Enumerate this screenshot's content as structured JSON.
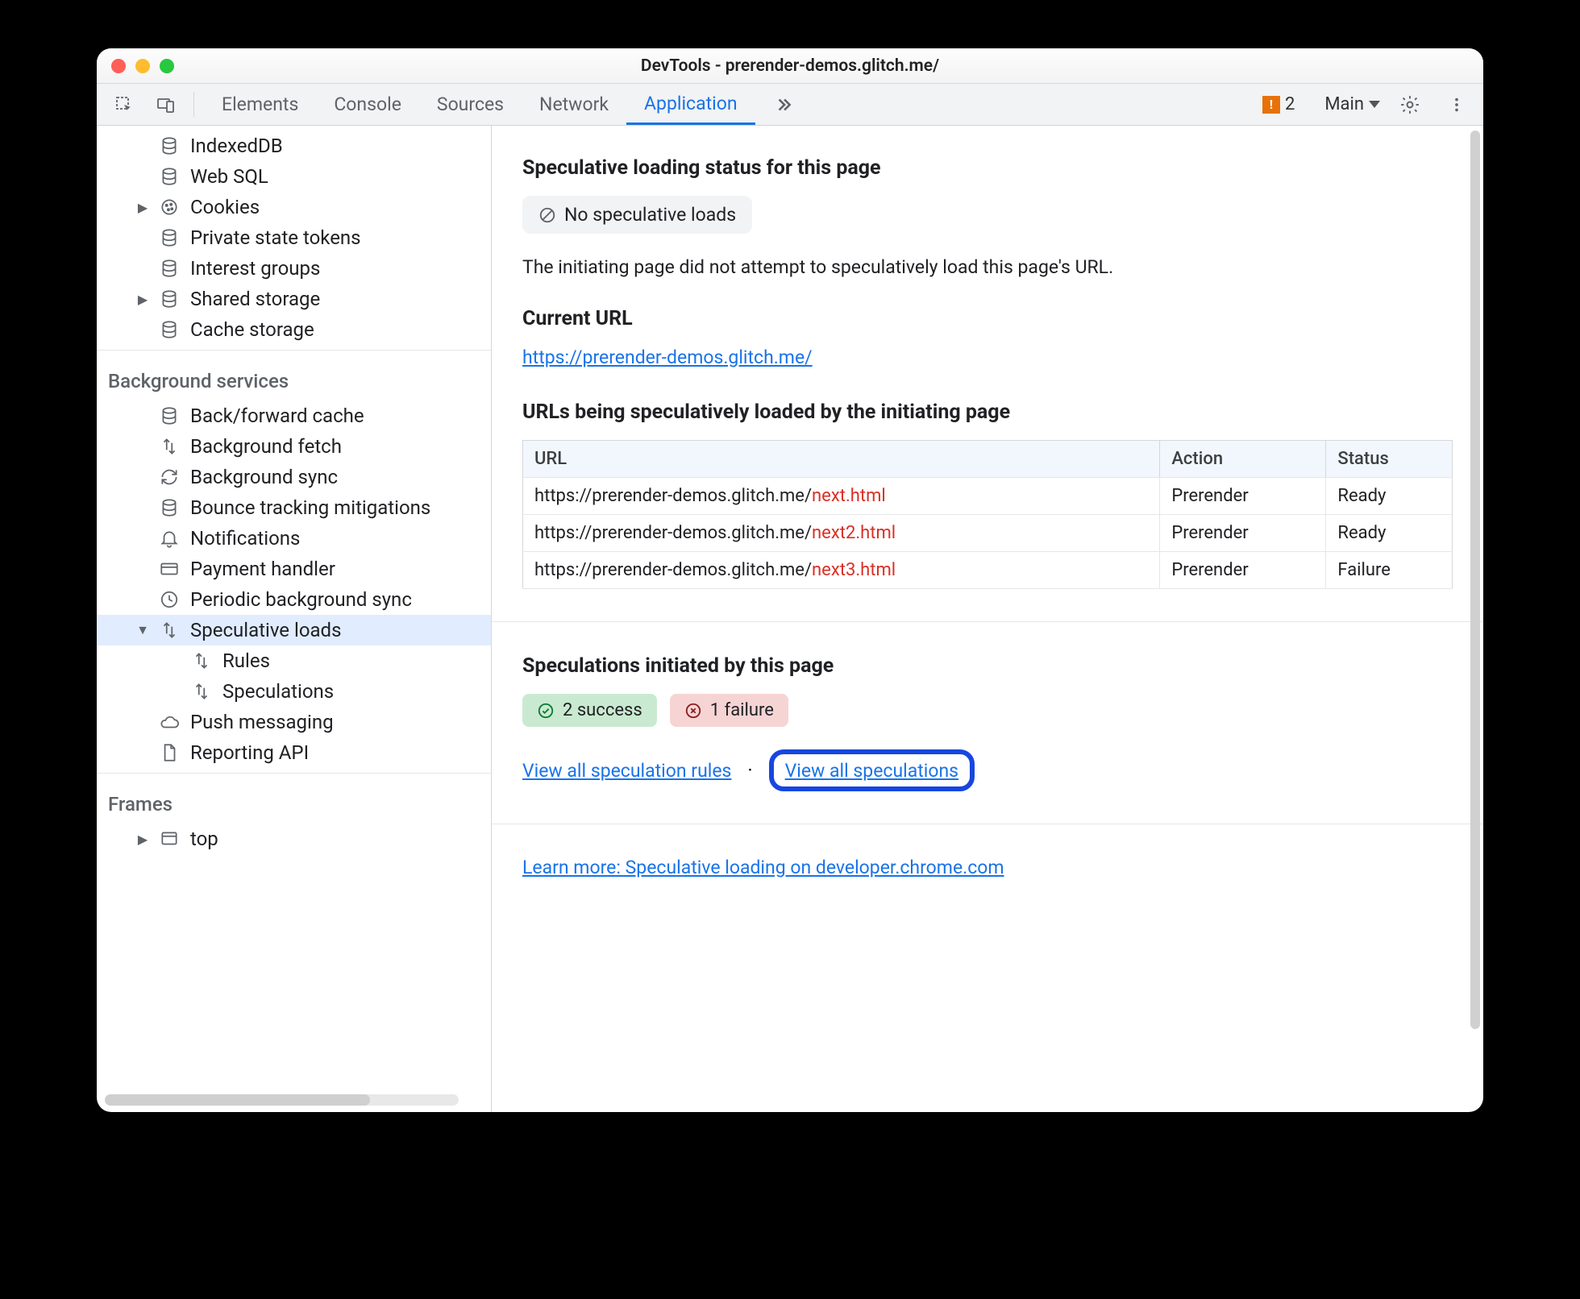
{
  "window": {
    "title": "DevTools - prerender-demos.glitch.me/"
  },
  "toolbar": {
    "tabs": [
      "Elements",
      "Console",
      "Sources",
      "Network",
      "Application"
    ],
    "active_tab": "Application",
    "issues_count": "2",
    "target_label": "Main"
  },
  "sidebar": {
    "storage_items": [
      {
        "label": "IndexedDB",
        "icon": "db"
      },
      {
        "label": "Web SQL",
        "icon": "db"
      },
      {
        "label": "Cookies",
        "icon": "cookie",
        "expandable": true
      },
      {
        "label": "Private state tokens",
        "icon": "db"
      },
      {
        "label": "Interest groups",
        "icon": "db"
      },
      {
        "label": "Shared storage",
        "icon": "db",
        "expandable": true
      },
      {
        "label": "Cache storage",
        "icon": "db"
      }
    ],
    "bg_label": "Background services",
    "bg_items": [
      {
        "label": "Back/forward cache",
        "icon": "db"
      },
      {
        "label": "Background fetch",
        "icon": "updown"
      },
      {
        "label": "Background sync",
        "icon": "sync"
      },
      {
        "label": "Bounce tracking mitigations",
        "icon": "db"
      },
      {
        "label": "Notifications",
        "icon": "bell"
      },
      {
        "label": "Payment handler",
        "icon": "card"
      },
      {
        "label": "Periodic background sync",
        "icon": "clock"
      },
      {
        "label": "Speculative loads",
        "icon": "updown",
        "expanded": true,
        "selected": true,
        "children": [
          {
            "label": "Rules",
            "icon": "updown"
          },
          {
            "label": "Speculations",
            "icon": "updown"
          }
        ]
      },
      {
        "label": "Push messaging",
        "icon": "cloud"
      },
      {
        "label": "Reporting API",
        "icon": "doc"
      }
    ],
    "frames_label": "Frames",
    "frames_items": [
      {
        "label": "top",
        "icon": "frame",
        "expandable": true
      }
    ]
  },
  "main": {
    "status_heading": "Speculative loading status for this page",
    "status_pill": "No speculative loads",
    "status_desc": "The initiating page did not attempt to speculatively load this page's URL.",
    "current_url_heading": "Current URL",
    "current_url": "https://prerender-demos.glitch.me/",
    "loaded_heading": "URLs being speculatively loaded by the initiating page",
    "table": {
      "headers": [
        "URL",
        "Action",
        "Status"
      ],
      "rows": [
        {
          "url_pre": "https://prerender-demos.glitch.me/",
          "url_red": "next.html",
          "action": "Prerender",
          "status": "Ready"
        },
        {
          "url_pre": "https://prerender-demos.glitch.me/",
          "url_red": "next2.html",
          "action": "Prerender",
          "status": "Ready"
        },
        {
          "url_pre": "https://prerender-demos.glitch.me/",
          "url_red": "next3.html",
          "action": "Prerender",
          "status": "Failure"
        }
      ]
    },
    "initiated_heading": "Speculations initiated by this page",
    "success_label": "2 success",
    "failure_label": "1 failure",
    "view_rules": "View all speculation rules",
    "view_specs": "View all speculations",
    "dot": "·",
    "learn_more": "Learn more: Speculative loading on developer.chrome.com"
  }
}
